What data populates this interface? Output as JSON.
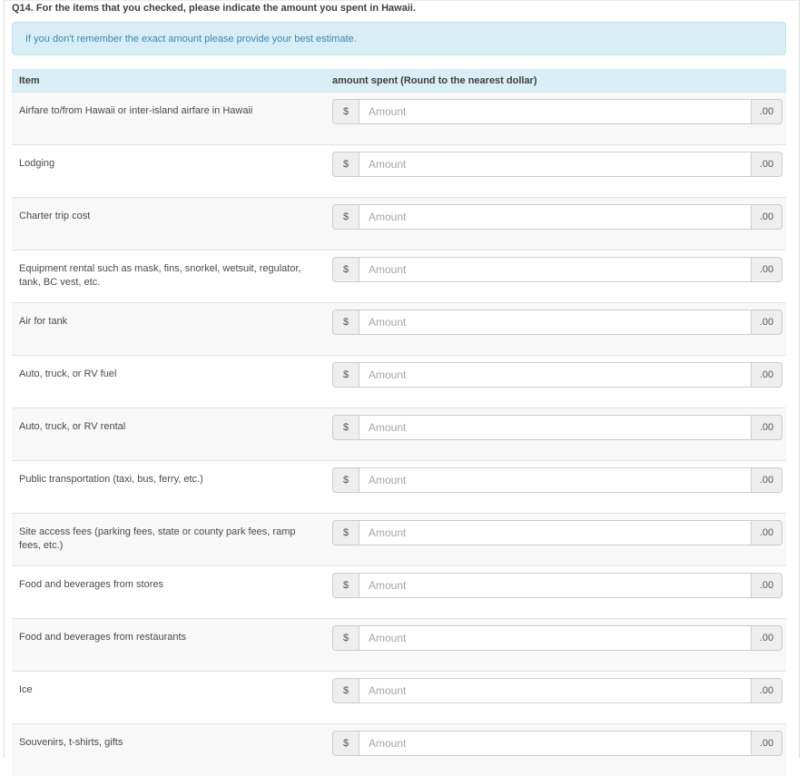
{
  "question": {
    "title": "Q14. For the items that you checked, please indicate the amount you spent in Hawaii.",
    "hint": "If you don't remember the exact amount please provide your best estimate."
  },
  "table": {
    "headers": {
      "item": "Item",
      "amount": "amount spent (Round to the nearest dollar)"
    },
    "currency_prefix": "$",
    "currency_suffix": ".00",
    "amount_placeholder": "Amount",
    "rows": [
      {
        "label": "Airfare to/from Hawaii or inter-island airfare in Hawaii",
        "value": ""
      },
      {
        "label": "Lodging",
        "value": ""
      },
      {
        "label": "Charter trip cost",
        "value": ""
      },
      {
        "label": "Equipment rental such as mask, fins, snorkel, wetsuit, regulator, tank, BC vest, etc.",
        "value": ""
      },
      {
        "label": "Air for tank",
        "value": ""
      },
      {
        "label": "Auto, truck, or RV fuel",
        "value": ""
      },
      {
        "label": "Auto, truck, or RV rental",
        "value": ""
      },
      {
        "label": "Public transportation (taxi, bus, ferry, etc.)",
        "value": ""
      },
      {
        "label": "Site access fees (parking fees, state or county park fees, ramp fees, etc.)",
        "value": ""
      },
      {
        "label": "Food and beverages from stores",
        "value": ""
      },
      {
        "label": "Food and beverages from restaurants",
        "value": ""
      },
      {
        "label": "Ice",
        "value": ""
      },
      {
        "label": "Souvenirs, t-shirts, gifts",
        "value": ""
      }
    ]
  },
  "colors": {
    "info_background": "#d9edf7",
    "info_border": "#c3e2ef",
    "info_text": "#3a87ad",
    "table_header_background": "#d9eef7",
    "stripe_row_background": "#f8f8f8",
    "row_divider": "#e2e2e2",
    "addon_background": "#eeeeee",
    "input_border": "#cccccc"
  }
}
